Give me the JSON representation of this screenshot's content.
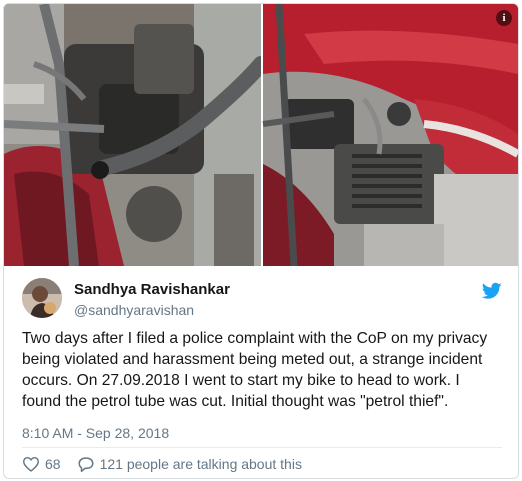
{
  "tweet": {
    "author_name": "Sandhya Ravishankar",
    "author_handle": "@sandhyaravishan",
    "text_lines": [
      "Two days after I filed a police complaint with the CoP on my privacy",
      "being violated and harassment being meted out, a strange incident",
      "occurs. On 27.09.2018 I went to start my bike to head to work. I",
      "found the petrol tube was cut. Initial thought was \"petrol thief\"."
    ],
    "timestamp": "8:10 AM - Sep 28, 2018",
    "likes": "68",
    "talking_about": "121 people are talking about this",
    "info_glyph": "i"
  },
  "icons": {
    "info": "info-icon",
    "bird": "twitter-bird-icon",
    "heart": "heart-icon",
    "reply": "reply-bubble-icon"
  },
  "colors": {
    "twitter_blue": "#1da1f2",
    "text": "#14171a",
    "muted": "#657786",
    "bike_red": "#b81f2e"
  },
  "media": {
    "images": [
      "motorcycle-petrol-tube-photo-1",
      "motorcycle-engine-photo-2"
    ]
  }
}
